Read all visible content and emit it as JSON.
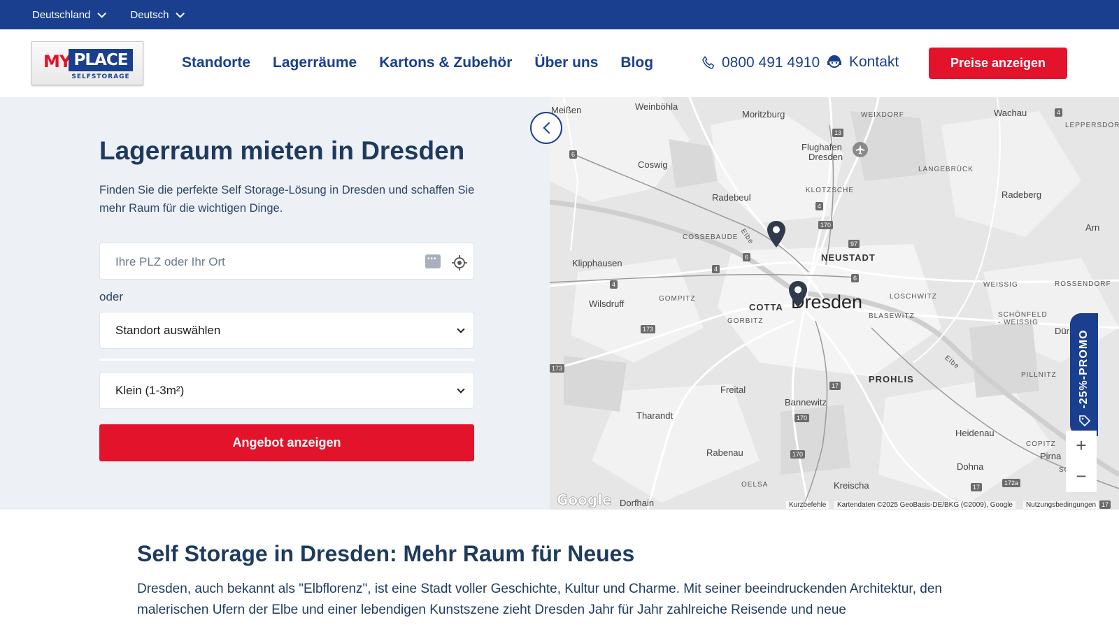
{
  "topbar": {
    "country": "Deutschland",
    "language": "Deutsch"
  },
  "header": {
    "logo": {
      "my": "MY",
      "place": "PLACE",
      "tagline": "SELFSTORAGE"
    },
    "nav": [
      "Standorte",
      "Lagerräume",
      "Kartons & Zubehör",
      "Über uns",
      "Blog"
    ],
    "phone": "0800 491 4910",
    "contact": "Kontakt",
    "cta": "Preise anzeigen"
  },
  "hero": {
    "title": "Lagerraum mieten in Dresden",
    "subtitle": "Finden Sie die perfekte Self Storage-Lösung in Dresden und schaffen Sie mehr Raum für die wichtigen Dinge.",
    "search_placeholder": "Ihre PLZ oder Ihr Ort",
    "or": "oder",
    "location_select": "Standort auswählen",
    "size_select": "Klein (1-3m²)",
    "offer_button": "Angebot anzeigen"
  },
  "map": {
    "labels": {
      "meissen": "Meißen",
      "weinboehla": "Weinböhla",
      "moritzburg": "Moritzburg",
      "weixdorf": "WEIXDORF",
      "wachau": "Wachau",
      "leppersdorf": "LEPPERSDORF",
      "flughafen": "Flughafen",
      "flughafen2": "Dresden",
      "coswig": "Coswig",
      "langebrueck": "LANGEBRÜCK",
      "radebeul": "Radebeul",
      "klotzsche": "KLOTZSCHE",
      "radeberg": "Radeberg",
      "cossebaude": "COSSEBAUDE",
      "neustadt": "NEUSTADT",
      "klipphausen": "Klipphausen",
      "weissig": "WEISSIG",
      "rossendorf": "ROSSENDORF",
      "wilsdruff": "Wilsdruff",
      "gompitz": "GOMPITZ",
      "cotta": "COTTA",
      "dresden": "Dresden",
      "loschwitz": "LOSCHWITZ",
      "blasewitz": "BLASEWITZ",
      "gorbitz": "GORBITZ",
      "schoenfeld": "SCHÖNFELD",
      "schoenfeld2": "- WEISSIG",
      "pillnitz": "PILLNITZ",
      "prohlis": "PROHLIS",
      "freital": "Freital",
      "bannewitz": "Bannewitz",
      "tharandt": "Tharandt",
      "heidenau": "Heidenau",
      "copitz": "COPITZ",
      "pirna": "Pirna",
      "rabenau": "Rabenau",
      "dohna": "Dohna",
      "oelsa": "OELSA",
      "kreischa": "Kreischa",
      "dorfhain": "Dorfhain",
      "elbe1": "Elbe",
      "elbe2": "Elbe",
      "arn": "Arn",
      "duerr": "Dürr",
      "sonne": "SONNE"
    },
    "shields": [
      "6",
      "13",
      "4",
      "170",
      "97",
      "6",
      "4",
      "4",
      "6",
      "173",
      "173",
      "17",
      "170",
      "170",
      "4",
      "172a",
      "17",
      "17"
    ],
    "promo": "-25%-PROMO",
    "zoom_in": "+",
    "zoom_out": "−",
    "google": "Google",
    "shortcuts": "Kurzbefehle",
    "map_data": "Kartendaten ©2025 GeoBasis-DE/BKG (©2009), Google",
    "terms": "Nutzungsbedingungen"
  },
  "content": {
    "title": "Self Storage in Dresden: Mehr Raum für Neues",
    "text": "Dresden, auch bekannt als \"Elbflorenz\", ist eine Stadt voller Geschichte, Kultur und Charme. Mit seiner beeindruckenden Architektur, den malerischen Ufern der Elbe und einer lebendigen Kunstszene zieht Dresden Jahr für Jahr zahlreiche Reisende und neue"
  },
  "colors": {
    "brand_blue": "#1a3f8f",
    "brand_red": "#e2132b",
    "hero_bg": "#edf0f5"
  }
}
